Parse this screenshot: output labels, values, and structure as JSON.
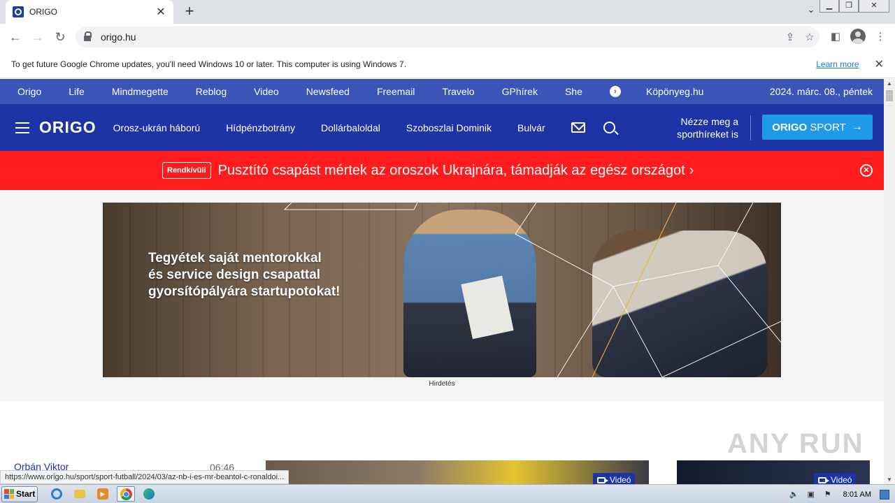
{
  "browser": {
    "tab_title": "ORIGO",
    "tab_close": "✕",
    "new_tab": "+",
    "url": "origo.hu",
    "status_url": "https://www.origo.hu/sport/sport-futball/2024/03/az-nb-i-es-mr-beantol-c-ronaldoi..."
  },
  "infobar": {
    "text": "To get future Google Chrome updates, you'll need Windows 10 or later. This computer is using Windows 7.",
    "link": "Learn more",
    "close": "✕"
  },
  "topnav": {
    "items": [
      "Origo",
      "Life",
      "Mindmegette",
      "Reblog",
      "Video",
      "Newsfeed",
      "Freemail",
      "Travelo",
      "GPhírek",
      "She"
    ],
    "after_arrow": "Köpönyeg.hu",
    "date": "2024. márc. 08., péntek"
  },
  "mainnav": {
    "logo": "ORIGO",
    "links": [
      "Orosz-ukrán háború",
      "Hídpénzbotrány",
      "Dollárbaloldal",
      "Szoboszlai Dominik",
      "Bulvár"
    ],
    "promo_line1": "Nézze meg a",
    "promo_line2": "sporthíreket is",
    "sport_bold": "ORIGO",
    "sport_rest": "SPORT"
  },
  "breaking": {
    "badge": "Rendkívüli",
    "headline": "Pusztító csapást mértek az oroszok Ukrajnára, támadják az egész országot",
    "chevron": "›"
  },
  "ad": {
    "text": "Tegyétek saját mentorokkal\nés service design csapattal\ngyorsítópályára startupotokat!",
    "label": "Hirdetés"
  },
  "feed": {
    "name": "Orbán Viktor",
    "time": "06:46",
    "video_label": "Videó"
  },
  "watermark": "ANY RUN",
  "taskbar": {
    "start": "Start",
    "clock": "8:01 AM"
  }
}
